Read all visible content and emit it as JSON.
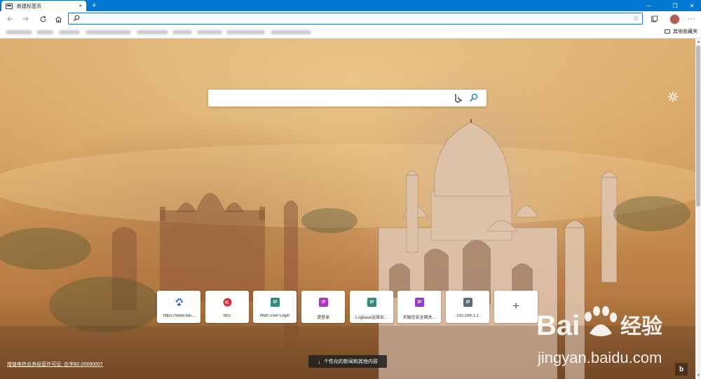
{
  "tab": {
    "title": "新建标签页",
    "close": "×"
  },
  "newtab": "+",
  "window": {
    "minimize": "─",
    "maximize": "❐",
    "close": "✕"
  },
  "address": {
    "placeholder": "",
    "value": "",
    "favorite": "☆"
  },
  "favorites": {
    "other_label": "其他收藏夹"
  },
  "search": {
    "placeholder": "",
    "value": ""
  },
  "tiles": [
    {
      "label": "https://www.bai...",
      "icon": "baidu-paw-icon",
      "color": "#2f6fe4"
    },
    {
      "label": "BIG",
      "icon": "f5-logo-icon",
      "color": "#d62d3a"
    },
    {
      "label": "Web User Login",
      "icon": "IP",
      "color": "#2e8c7d"
    },
    {
      "label": "请登录",
      "icon": "IP",
      "color": "#b433c8"
    },
    {
      "label": "Logbase运维安...",
      "icon": "IP",
      "color": "#2e8c7d"
    },
    {
      "label": "天融信安全网关...",
      "icon": "IP",
      "color": "#9a3bc7"
    },
    {
      "label": "192.168.1.1",
      "icon": "IP",
      "color": "#56707a"
    }
  ],
  "add_tile": "+",
  "footer": {
    "license": "增值电信业务经营许可证: 合字B2-20090007",
    "news_button": "个性化的新闻和其他内容"
  },
  "watermark": {
    "brand": "Bai",
    "brand2": "du",
    "cn": "经验",
    "url": "jingyan.baidu.com"
  }
}
